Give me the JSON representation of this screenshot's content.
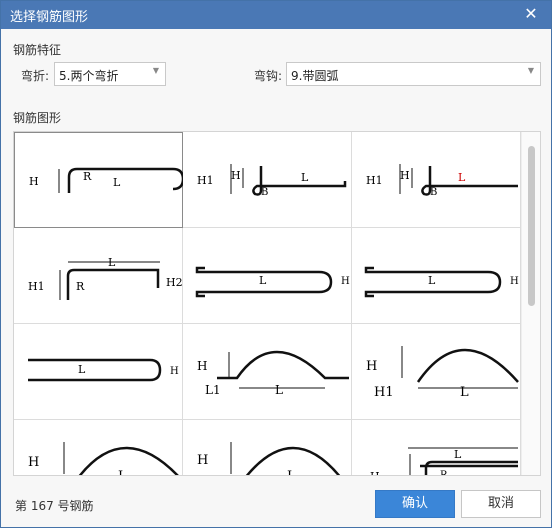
{
  "dialog": {
    "title": "选择钢筋图形",
    "close_symbol": "✕"
  },
  "features": {
    "section_label": "钢筋特征",
    "bend_label": "弯折:",
    "bend_value": "5.两个弯折",
    "hook_label": "弯钩:",
    "hook_value": "9.带圆弧"
  },
  "shapes": {
    "section_label": "钢筋图形",
    "cells": [
      {
        "labels": [
          "H",
          "R",
          "L"
        ]
      },
      {
        "labels": [
          "H1",
          "H",
          "L",
          "B"
        ]
      },
      {
        "labels": [
          "H1",
          "H",
          "L",
          "B"
        ]
      },
      {
        "labels": [
          "L",
          "H1",
          "R",
          "H2"
        ]
      },
      {
        "labels": [
          "L",
          "H"
        ]
      },
      {
        "labels": [
          "L",
          "H"
        ]
      },
      {
        "labels": [
          "L",
          "H"
        ]
      },
      {
        "labels": [
          "H",
          "L1",
          "L"
        ]
      },
      {
        "labels": [
          "H",
          "H1",
          "L"
        ]
      },
      {
        "labels": [
          "H",
          "L"
        ]
      },
      {
        "labels": [
          "H",
          "L"
        ]
      },
      {
        "labels": [
          "H",
          "L",
          "R"
        ]
      }
    ]
  },
  "status": {
    "text": "第 167 号钢筋"
  },
  "buttons": {
    "confirm": "确认",
    "cancel": "取消"
  },
  "colors": {
    "title_bar": "#4a78b5",
    "primary_button": "#3b86d8",
    "highlight_label": "#cc0000"
  }
}
